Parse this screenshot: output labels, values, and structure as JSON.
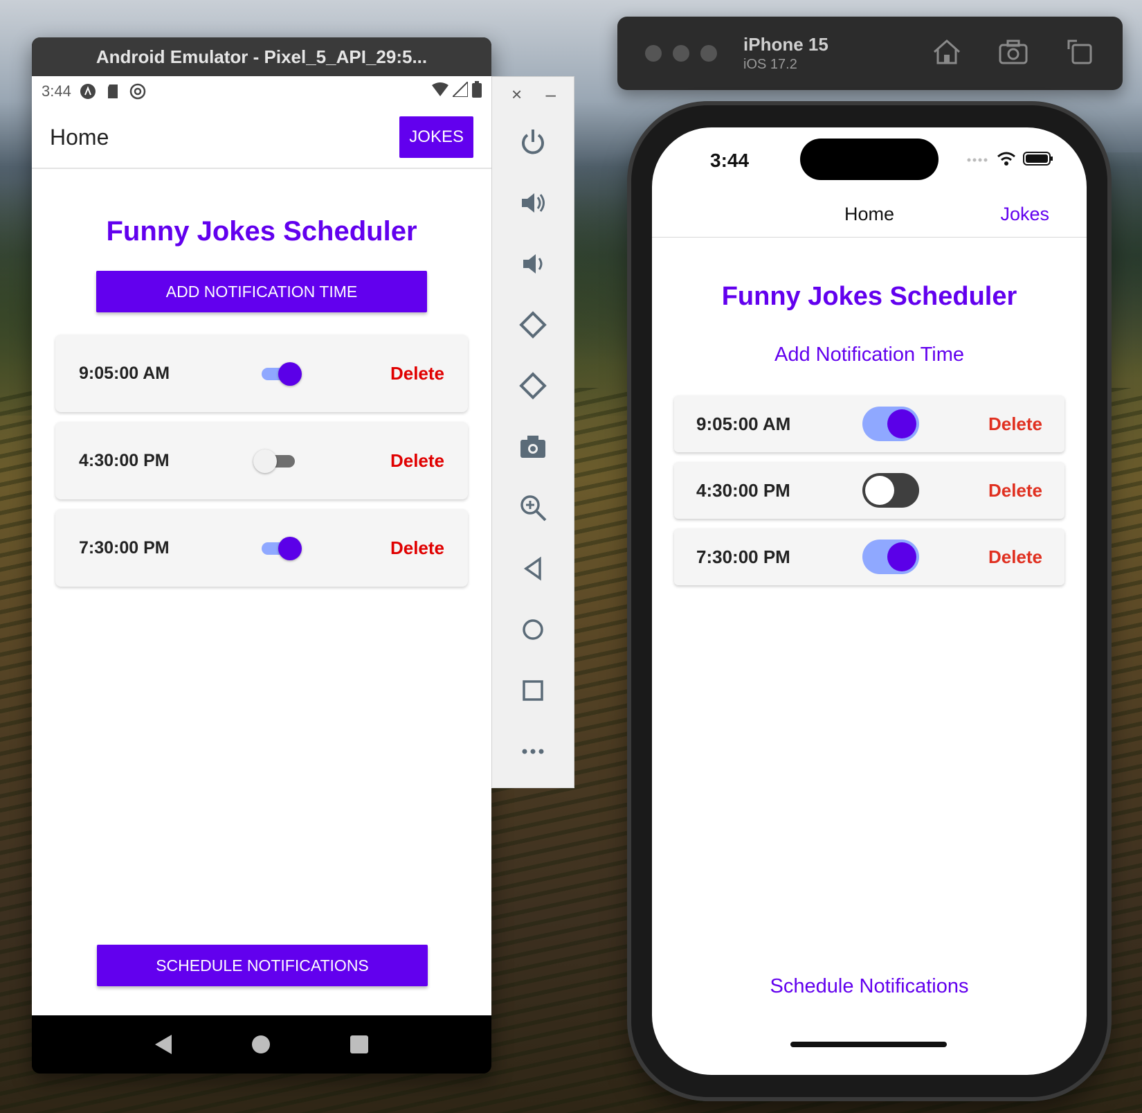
{
  "android": {
    "window_title": "Android Emulator - Pixel_5_API_29:5...",
    "status_time": "3:44",
    "app_title": "Home",
    "jokes_button": "JOKES",
    "heading": "Funny Jokes Scheduler",
    "add_button": "ADD NOTIFICATION TIME",
    "rows": [
      {
        "time": "9:05:00 AM",
        "enabled": true,
        "delete": "Delete"
      },
      {
        "time": "4:30:00 PM",
        "enabled": false,
        "delete": "Delete"
      },
      {
        "time": "7:30:00 PM",
        "enabled": true,
        "delete": "Delete"
      }
    ],
    "schedule_button": "SCHEDULE NOTIFICATIONS"
  },
  "emulator_toolbar": {
    "close_glyph": "×",
    "minimize_glyph": "–",
    "tools": [
      "power-icon",
      "volume-up-icon",
      "volume-down-icon",
      "rotate-left-icon",
      "rotate-right-icon",
      "camera-icon",
      "zoom-icon",
      "back-icon",
      "home-icon",
      "overview-icon",
      "more-icon"
    ]
  },
  "ios_simulator": {
    "device_name": "iPhone 15",
    "os_version": "iOS 17.2",
    "status_time": "3:44",
    "nav_title": "Home",
    "nav_jokes": "Jokes",
    "heading": "Funny Jokes Scheduler",
    "add_link": "Add Notification Time",
    "rows": [
      {
        "time": "9:05:00 AM",
        "enabled": true,
        "delete": "Delete"
      },
      {
        "time": "4:30:00 PM",
        "enabled": false,
        "delete": "Delete"
      },
      {
        "time": "7:30:00 PM",
        "enabled": true,
        "delete": "Delete"
      }
    ],
    "schedule_link": "Schedule Notifications"
  },
  "colors": {
    "accent": "#6200ee",
    "delete": "#e00000",
    "switch_track_on": "#8fa8ff",
    "switch_thumb_on": "#5b00e8"
  }
}
